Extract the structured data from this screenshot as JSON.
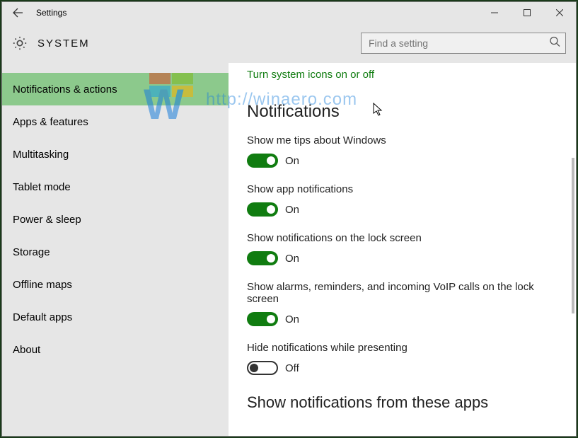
{
  "window": {
    "title": "Settings"
  },
  "header": {
    "title": "SYSTEM"
  },
  "search": {
    "placeholder": "Find a setting"
  },
  "sidebar": {
    "items": [
      {
        "label": "Notifications & actions",
        "selected": true
      },
      {
        "label": "Apps & features"
      },
      {
        "label": "Multitasking"
      },
      {
        "label": "Tablet mode"
      },
      {
        "label": "Power & sleep"
      },
      {
        "label": "Storage"
      },
      {
        "label": "Offline maps"
      },
      {
        "label": "Default apps"
      },
      {
        "label": "About"
      }
    ]
  },
  "main": {
    "link": "Turn system icons on or off",
    "section_title": "Notifications",
    "options": [
      {
        "label": "Show me tips about Windows",
        "on": true,
        "state": "On"
      },
      {
        "label": "Show app notifications",
        "on": true,
        "state": "On"
      },
      {
        "label": "Show notifications on the lock screen",
        "on": true,
        "state": "On"
      },
      {
        "label": "Show alarms, reminders, and incoming VoIP calls on the lock screen",
        "on": true,
        "state": "On"
      },
      {
        "label": "Hide notifications while presenting",
        "on": false,
        "state": "Off"
      }
    ],
    "section2_title": "Show notifications from these apps"
  },
  "watermark": {
    "url": "http://winaero.com"
  }
}
